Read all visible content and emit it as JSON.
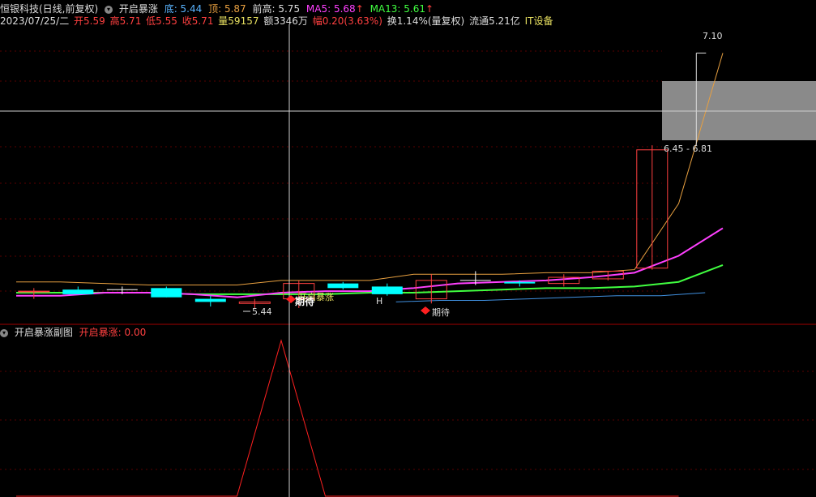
{
  "header": {
    "stock": "恒银科技(日线,前复权)",
    "indicator": "开启暴涨",
    "bottom": "底: 5.44",
    "top": "顶: 5.87",
    "prev_high": "前高: 5.75",
    "ma5": "MA5: 5.68",
    "ma5_arrow": "↑",
    "ma13": "MA13: 5.61",
    "ma13_arrow": "↑"
  },
  "info": {
    "date": "2023/07/25/二",
    "open": "开5.59",
    "high": "高5.71",
    "low": "低5.55",
    "close": "收5.71",
    "vol": "量59157",
    "amt": "额3346万",
    "chg": "幅0.20(3.63%)",
    "turnover": "换1.14%(量复权)",
    "float": "流通5.21亿",
    "sector": "IT设备"
  },
  "main": {
    "label_target": "7.10",
    "label_range": "6.45 - 6.81",
    "label_low": "5.44",
    "label_open_surge": "开启暴涨",
    "label_expect": "期待",
    "label_expect2": "期待",
    "label_H": "H"
  },
  "sub": {
    "title": "开启暴涨副图",
    "value": "开启暴涨: 0.00"
  },
  "colors": {
    "up": "#ff4040",
    "down": "#00ffff",
    "ma5": "#ff40ff",
    "ma13": "#40ff40",
    "upper": "#e8a040",
    "lower": "#4090e0",
    "grid": "#5a0000",
    "sub": "#ff2020"
  },
  "chart_data": {
    "type": "candlestick",
    "ylim": [
      5.35,
      7.25
    ],
    "candles": [
      {
        "o": 5.55,
        "h": 5.57,
        "l": 5.5,
        "c": 5.55,
        "dir": "up"
      },
      {
        "o": 5.56,
        "h": 5.58,
        "l": 5.53,
        "c": 5.53,
        "dir": "down"
      },
      {
        "o": 5.56,
        "h": 5.58,
        "l": 5.53,
        "c": 5.56,
        "dir": "flat"
      },
      {
        "o": 5.57,
        "h": 5.58,
        "l": 5.51,
        "c": 5.51,
        "dir": "down"
      },
      {
        "o": 5.5,
        "h": 5.52,
        "l": 5.45,
        "c": 5.48,
        "dir": "down"
      },
      {
        "o": 5.48,
        "h": 5.5,
        "l": 5.44,
        "c": 5.47,
        "dir": "up"
      },
      {
        "o": 5.5,
        "h": 5.62,
        "l": 5.44,
        "c": 5.6,
        "dir": "up"
      },
      {
        "o": 5.6,
        "h": 5.61,
        "l": 5.56,
        "c": 5.57,
        "dir": "down"
      },
      {
        "o": 5.58,
        "h": 5.6,
        "l": 5.52,
        "c": 5.53,
        "dir": "down"
      },
      {
        "o": 5.5,
        "h": 5.66,
        "l": 5.47,
        "c": 5.62,
        "dir": "up"
      },
      {
        "o": 5.62,
        "h": 5.68,
        "l": 5.59,
        "c": 5.62,
        "dir": "flat"
      },
      {
        "o": 5.61,
        "h": 5.62,
        "l": 5.58,
        "c": 5.6,
        "dir": "down"
      },
      {
        "o": 5.6,
        "h": 5.66,
        "l": 5.58,
        "c": 5.64,
        "dir": "up"
      },
      {
        "o": 5.63,
        "h": 5.68,
        "l": 5.62,
        "c": 5.68,
        "dir": "up"
      },
      {
        "o": 5.7,
        "h": 6.5,
        "l": 5.69,
        "c": 6.47,
        "dir": "up"
      }
    ],
    "ma5": [
      5.52,
      5.52,
      5.54,
      5.54,
      5.53,
      5.51,
      5.54,
      5.55,
      5.55,
      5.57,
      5.6,
      5.61,
      5.62,
      5.64,
      5.67,
      5.78,
      5.96
    ],
    "ma13": [
      5.54,
      5.54,
      5.54,
      5.54,
      5.53,
      5.53,
      5.53,
      5.53,
      5.54,
      5.54,
      5.55,
      5.56,
      5.57,
      5.57,
      5.58,
      5.61,
      5.72
    ],
    "upper": [
      5.61,
      5.61,
      5.6,
      5.59,
      5.59,
      5.59,
      5.62,
      5.62,
      5.62,
      5.66,
      5.66,
      5.66,
      5.67,
      5.67,
      5.69,
      6.12,
      7.1
    ],
    "lower": [
      5.48,
      5.49,
      5.49,
      5.5,
      5.51,
      5.52,
      5.52,
      5.54
    ],
    "sub_values": [
      0,
      0,
      0,
      0,
      0,
      0,
      1,
      0,
      0,
      0,
      0,
      0,
      0,
      0,
      0,
      0
    ]
  }
}
